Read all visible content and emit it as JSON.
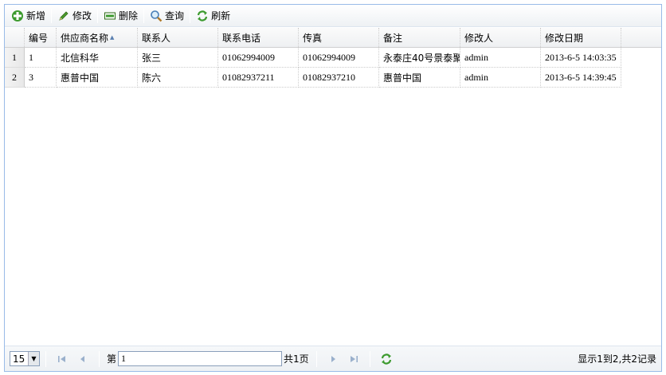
{
  "toolbar": {
    "add_label": "新增",
    "edit_label": "修改",
    "delete_label": "删除",
    "search_label": "查询",
    "refresh_label": "刷新"
  },
  "grid": {
    "columns": [
      "编号",
      "供应商名称",
      "联系人",
      "联系电话",
      "传真",
      "备注",
      "修改人",
      "修改日期"
    ],
    "rows": [
      {
        "rownum": "1",
        "id": "1",
        "name": "北信科华",
        "contact": "张三",
        "phone": "01062994009",
        "fax": "01062994009",
        "remark": "永泰庄40号景泰聚",
        "modifier": "admin",
        "date": "2013-6-5 14:03:35"
      },
      {
        "rownum": "2",
        "id": "3",
        "name": "惠普中国",
        "contact": "陈六",
        "phone": "01082937211",
        "fax": "01082937210",
        "remark": "惠普中国",
        "modifier": "admin",
        "date": "2013-6-5 14:39:45"
      }
    ]
  },
  "pager": {
    "page_size": "15",
    "page_label": "第",
    "page_value": "1",
    "total_pages": "共1页",
    "info": "显示1到2,共2记录"
  },
  "colors": {
    "border": "#99bbe8",
    "accent_green": "#3a9a2a"
  }
}
